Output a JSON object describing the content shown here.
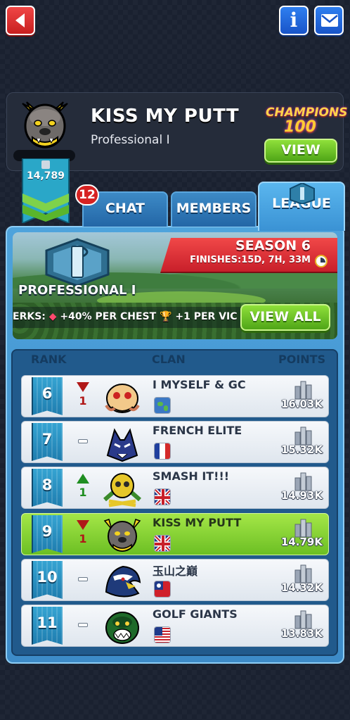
{
  "header": {
    "clan_name": "KISS MY PUTT",
    "division": "Professional I",
    "trophies": "14,789",
    "champions_logo_text": "CHAMPIONS",
    "champions_logo_number": "100",
    "view_button": "VIEW"
  },
  "tabs": {
    "chat_badge": "12",
    "chat": "CHAT",
    "members": "MEMBERS",
    "league": "LEAGUE"
  },
  "season": {
    "title": "SEASON 6",
    "finishes": "FINISHES:15D, 7H, 33M",
    "division_label": "PROFESSIONAL I",
    "perks_prefix": "ERKS:",
    "perk_chest": "+40% PER CHEST",
    "perk_trophy": "+1 PER VIC",
    "view_all_button": "VIEW ALL"
  },
  "columns": {
    "rank": "RANK",
    "clan": "CLAN",
    "points": "POINTS"
  },
  "rows": [
    {
      "rank": "6",
      "trend": "down",
      "change": "1",
      "name": "I MYSELF & GC",
      "flag": "world",
      "points": "16.03K",
      "emblem": "skull-emblem",
      "highlight": false
    },
    {
      "rank": "7",
      "trend": "none",
      "change": "",
      "name": "FRENCH ELITE",
      "flag": "france",
      "points": "15.32K",
      "emblem": "wolf-emblem",
      "highlight": false
    },
    {
      "rank": "8",
      "trend": "up",
      "change": "1",
      "name": "SMASH IT!!!",
      "flag": "uk",
      "points": "14.93K",
      "emblem": "golden-skull-emblem",
      "highlight": false
    },
    {
      "rank": "9",
      "trend": "down",
      "change": "1",
      "name": "KISS MY PUTT",
      "flag": "uk",
      "points": "14.79K",
      "emblem": "bulldog-emblem",
      "highlight": true
    },
    {
      "rank": "10",
      "trend": "none",
      "change": "",
      "name": "玉山之巔",
      "flag": "taiwan",
      "points": "14.32K",
      "emblem": "eagle-emblem",
      "highlight": false
    },
    {
      "rank": "11",
      "trend": "none",
      "change": "",
      "name": "GOLF GIANTS",
      "flag": "usa",
      "points": "13.83K",
      "emblem": "gorilla-emblem",
      "highlight": false
    }
  ],
  "colors": {
    "accent_green": "#6cbf24",
    "accent_blue": "#3d8bc8",
    "accent_red": "#d62222"
  }
}
